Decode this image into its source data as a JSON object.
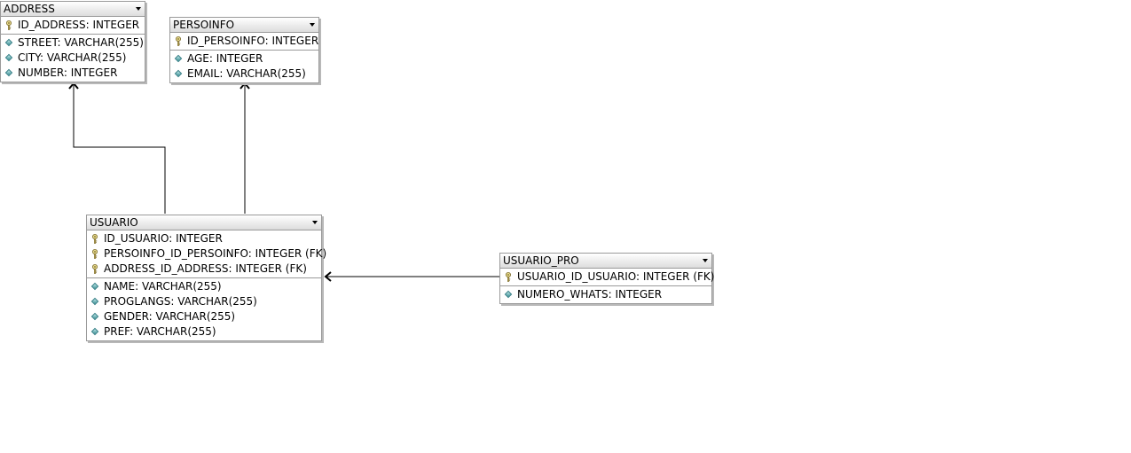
{
  "entities": {
    "address": {
      "name": "ADDRESS",
      "key_fields": [
        "ID_ADDRESS: INTEGER"
      ],
      "fields": [
        "STREET: VARCHAR(255)",
        "CITY: VARCHAR(255)",
        "NUMBER: INTEGER"
      ]
    },
    "persoinfo": {
      "name": "PERSOINFO",
      "key_fields": [
        "ID_PERSOINFO: INTEGER"
      ],
      "fields": [
        "AGE: INTEGER",
        "EMAIL: VARCHAR(255)"
      ]
    },
    "usuario": {
      "name": "USUARIO",
      "key_fields": [
        "ID_USUARIO: INTEGER",
        "PERSOINFO_ID_PERSOINFO: INTEGER (FK)",
        "ADDRESS_ID_ADDRESS: INTEGER (FK)"
      ],
      "fields": [
        "NAME: VARCHAR(255)",
        "PROGLANGS: VARCHAR(255)",
        "GENDER: VARCHAR(255)",
        "PREF: VARCHAR(255)"
      ]
    },
    "usuario_pro": {
      "name": "USUARIO_PRO",
      "key_fields": [
        "USUARIO_ID_USUARIO: INTEGER (FK)"
      ],
      "fields": [
        "NUMERO_WHATS: INTEGER"
      ]
    }
  },
  "relationships": [
    {
      "from": "usuario",
      "to": "address"
    },
    {
      "from": "usuario",
      "to": "persoinfo"
    },
    {
      "from": "usuario_pro",
      "to": "usuario"
    }
  ],
  "colors": {
    "border": "#9a9a9a",
    "line": "#000000",
    "attribute_diamond": "#3a8f95",
    "key_icon": "#b8a65a"
  }
}
